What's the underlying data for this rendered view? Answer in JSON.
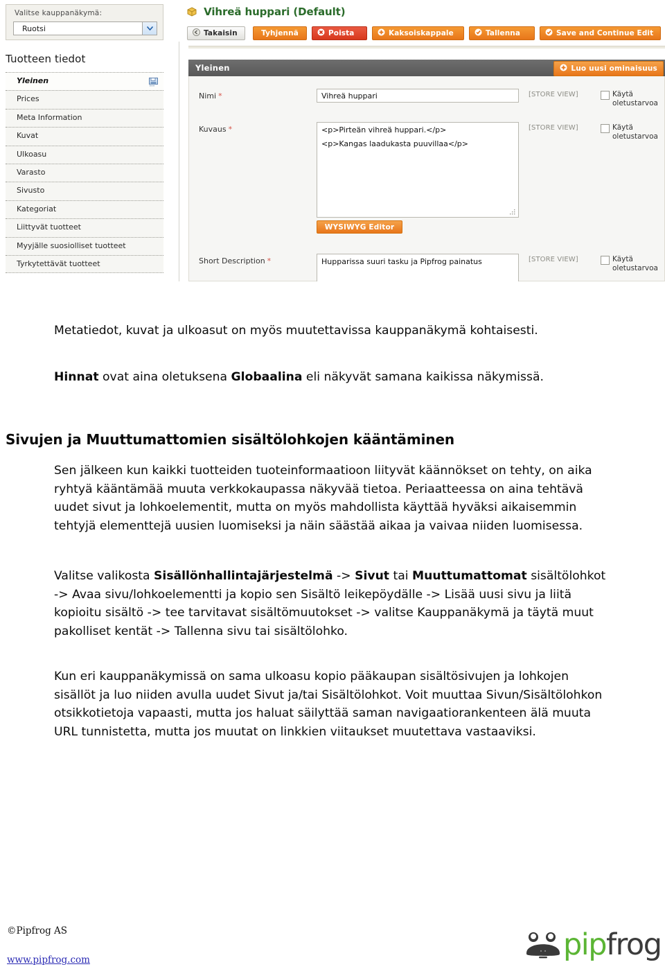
{
  "screenshot": {
    "store_view_selector": {
      "label": "Valitse kauppanäkymä:",
      "selected": "Ruotsi"
    },
    "panel_title": "Tuotteen tiedot",
    "tabs": [
      {
        "label": "Yleinen",
        "active": true,
        "has_save_icon": true
      },
      {
        "label": "Prices",
        "active": false,
        "has_save_icon": false
      },
      {
        "label": "Meta Information",
        "active": false,
        "has_save_icon": false
      },
      {
        "label": "Kuvat",
        "active": false,
        "has_save_icon": false
      },
      {
        "label": "Ulkoasu",
        "active": false,
        "has_save_icon": false
      },
      {
        "label": "Varasto",
        "active": false,
        "has_save_icon": false
      },
      {
        "label": "Sivusto",
        "active": false,
        "has_save_icon": false
      },
      {
        "label": "Kategoriat",
        "active": false,
        "has_save_icon": false
      },
      {
        "label": "Liittyvät tuotteet",
        "active": false,
        "has_save_icon": false
      },
      {
        "label": "Myyjälle suosiolliset tuotteet",
        "active": false,
        "has_save_icon": false
      },
      {
        "label": "Tyrkytettävät tuotteet",
        "active": false,
        "has_save_icon": false
      }
    ],
    "product_title": "Vihreä huppari (Default)",
    "toolbar": [
      {
        "label": "Takaisin",
        "style": "grey",
        "icon": "back-icon"
      },
      {
        "label": "Tyhjennä",
        "style": "orange",
        "icon": "none"
      },
      {
        "label": "Poista",
        "style": "red",
        "icon": "delete-icon"
      },
      {
        "label": "Kaksoiskappale",
        "style": "orange",
        "icon": "plus-icon"
      },
      {
        "label": "Tallenna",
        "style": "orange",
        "icon": "check-icon"
      },
      {
        "label": "Save and Continue Edit",
        "style": "orange",
        "icon": "check-icon"
      }
    ],
    "fieldset": {
      "title": "Yleinen",
      "new_attribute_button": "Luo uusi ominaisuus",
      "scope_label": "[STORE VIEW]",
      "use_default_label": "Käytä oletustarvoa",
      "wysiwyg_button": "WYSIWYG Editor",
      "fields": [
        {
          "label": "Nimi",
          "required": "*",
          "value": "Vihreä huppari"
        },
        {
          "label": "Kuvaus",
          "required": "*",
          "value_line1": "<p>Pirteän vihreä huppari.</p>",
          "value_line2": "<p>Kangas laadukasta puuvillaa</p>"
        },
        {
          "label": "Short Description",
          "required": "*",
          "value": "Hupparissa suuri tasku ja Pipfrog painatus"
        }
      ]
    },
    "colors": {
      "orange": "#e8761a",
      "red": "#d8381c",
      "header_grey": "#5f5f5f",
      "title_green": "#2a6b2a"
    }
  },
  "document": {
    "paragraph_1": "Metatiedot, kuvat ja ulkoasut on myös muutettavissa kauppanäkymä kohtaisesti.",
    "paragraph_2_parts": [
      {
        "text": "Hinnat",
        "bold": true
      },
      {
        "text": " ovat aina oletuksena ",
        "bold": false
      },
      {
        "text": "Globaalina",
        "bold": true
      },
      {
        "text": " eli näkyvät samana kaikissa näkymissä.",
        "bold": false
      }
    ],
    "heading": "Sivujen ja Muuttumattomien sisältölohkojen kääntäminen",
    "paragraph_3": "Sen jälkeen kun kaikki tuotteiden tuoteinformaatioon liityvät käännökset on tehty, on aika ryhtyä kääntämää muuta verkkokaupassa näkyvää tietoa. Periaatteessa on aina tehtävä uudet sivut ja lohkoelementit, mutta on myös mahdollista käyttää hyväksi aikaisemmin tehtyjä elementtejä uusien luomiseksi ja näin säästää aikaa ja vaivaa niiden luomisessa.",
    "paragraph_4_parts": [
      {
        "text": "Valitse valikosta ",
        "bold": false
      },
      {
        "text": "Sisällönhallintajärjestelmä",
        "bold": true
      },
      {
        "text": " -> ",
        "bold": false
      },
      {
        "text": "Sivut",
        "bold": true
      },
      {
        "text": " tai ",
        "bold": false
      },
      {
        "text": "Muuttumattomat",
        "bold": true
      },
      {
        "text": " sisältölohkot -> Avaa sivu/lohkoelementti ja kopio sen Sisältö leikepöydälle -> Lisää uusi sivu ja liitä kopioitu sisältö  -> tee tarvitavat sisältömuutokset -> valitse Kauppanäkymä ja täytä muut pakolliset kentät -> Tallenna sivu tai sisältölohko.",
        "bold": false
      }
    ],
    "paragraph_5": "Kun eri kauppanäkymissä on sama ulkoasu kopio pääkaupan sisältösivujen ja lohkojen sisällöt ja luo niiden avulla uudet Sivut ja/tai Sisältölohkot. Voit muuttaa Sivun/Sisältölohkon otsikkotietoja vapaasti, mutta jos haluat säilyttää saman navigaatiorankenteen älä muuta URL tunnistetta, mutta jos muutat on linkkien viitaukset muutettava vastaaviksi."
  },
  "footer": {
    "copyright": "©Pipfrog AS",
    "website": "www.pipfrog.com",
    "logo_text_1": "pip",
    "logo_text_2": "frog"
  }
}
